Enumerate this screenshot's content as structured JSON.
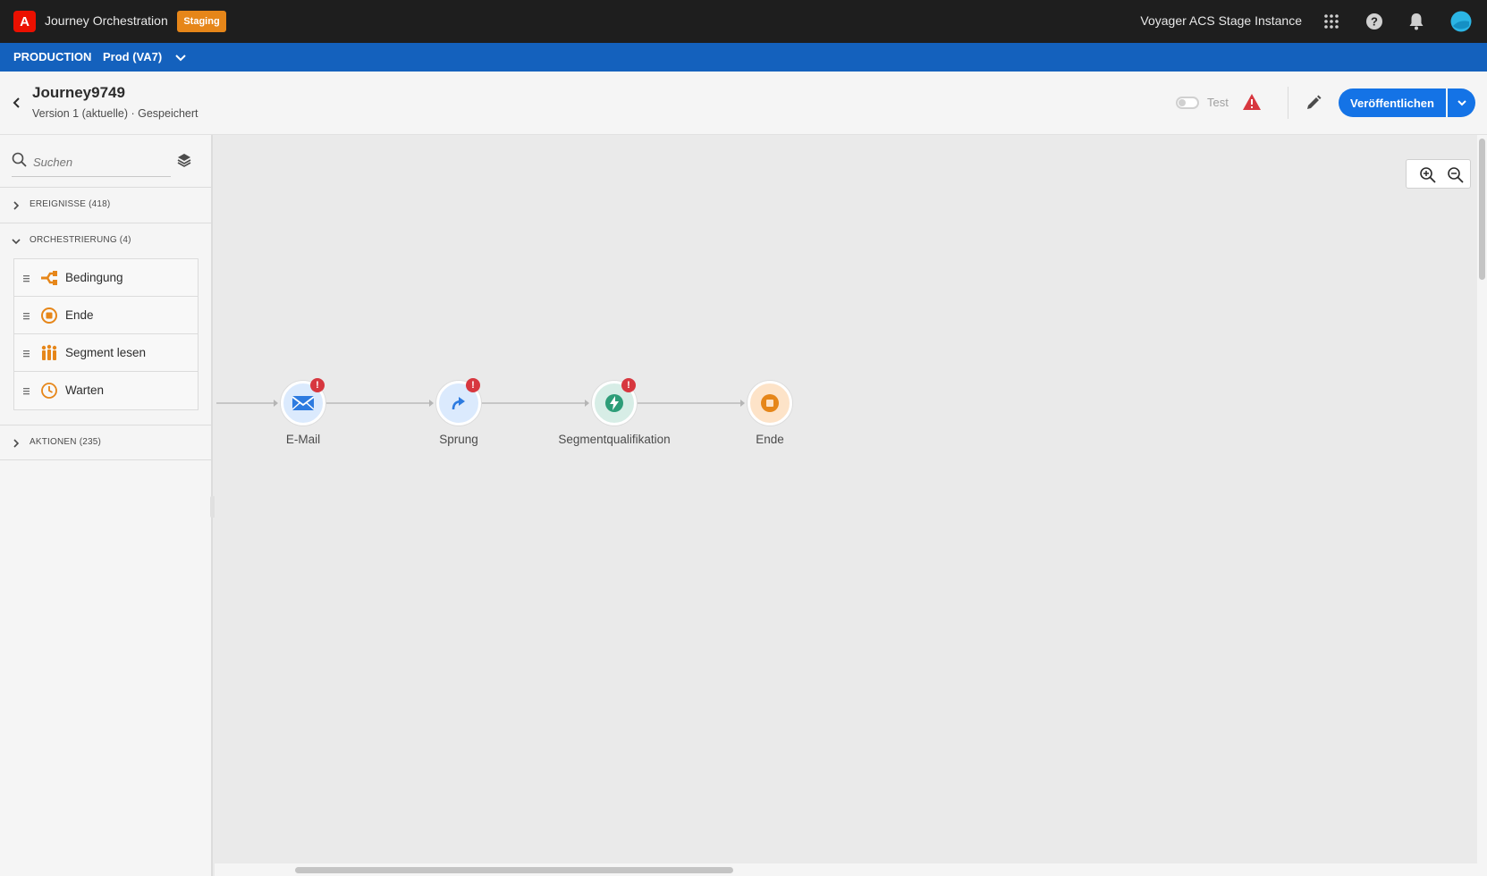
{
  "topbar": {
    "app_title": "Journey Orchestration",
    "env_badge": "Staging",
    "org_name": "Voyager ACS Stage Instance"
  },
  "sandbox": {
    "label": "PRODUCTION",
    "name": "Prod (VA7)"
  },
  "journey": {
    "name": "Journey9749",
    "subtitle": "Version 1 (aktuelle) · Gespeichert",
    "test_label": "Test",
    "publish_label": "Veröffentlichen"
  },
  "sidebar": {
    "search_placeholder": "Suchen",
    "sections": [
      {
        "label": "EREIGNISSE (418)",
        "expanded": false
      },
      {
        "label": "ORCHESTRIERUNG (4)",
        "expanded": true
      },
      {
        "label": "AKTIONEN (235)",
        "expanded": false
      }
    ],
    "orchestration_items": [
      {
        "label": "Bedingung",
        "icon": "condition-icon"
      },
      {
        "label": "Ende",
        "icon": "end-icon"
      },
      {
        "label": "Segment lesen",
        "icon": "read-segment-icon"
      },
      {
        "label": "Warten",
        "icon": "wait-icon"
      }
    ]
  },
  "canvas": {
    "nodes": [
      {
        "label": "E-Mail",
        "icon": "email-icon",
        "has_error": true,
        "color": "#dbeafd"
      },
      {
        "label": "Sprung",
        "icon": "jump-icon",
        "has_error": true,
        "color": "#dbeafd"
      },
      {
        "label": "Segmentqualifikation",
        "icon": "segment-qualification-icon",
        "has_error": true,
        "color": "#d7ede6"
      },
      {
        "label": "Ende",
        "icon": "end-icon",
        "has_error": false,
        "color": "#fde3c8"
      }
    ],
    "error_glyph": "!"
  },
  "colors": {
    "accent": "#1473e6",
    "sandbox_bar": "#1461bd",
    "staging": "#e68619",
    "error": "#d7373f",
    "orchestration_orange": "#e68619"
  }
}
